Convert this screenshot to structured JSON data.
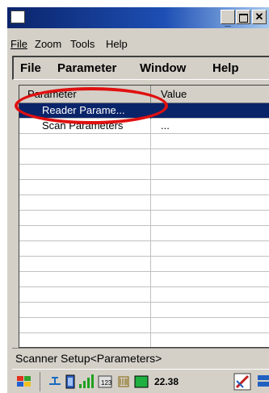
{
  "window": {
    "title": ""
  },
  "menubar_primary": {
    "items": [
      {
        "label": "File",
        "mnemonic": "F"
      },
      {
        "label": "Zoom",
        "mnemonic": "Z"
      },
      {
        "label": "Tools",
        "mnemonic": "T"
      },
      {
        "label": "Help",
        "mnemonic": "H"
      }
    ]
  },
  "menubar_secondary": {
    "items": [
      "File",
      "Parameter",
      "Window",
      "Help"
    ]
  },
  "grid": {
    "columns": [
      "Parameter",
      "Value"
    ],
    "rows": [
      {
        "parameter": "Reader Parame...",
        "value": "",
        "selected": true
      },
      {
        "parameter": "Scan Parameters",
        "value": "...",
        "selected": false
      }
    ],
    "empty_rows": 14
  },
  "status_bar": {
    "text": "Scanner Setup<Parameters>"
  },
  "taskbar": {
    "clock": "22.38",
    "icons": [
      "start-flag-icon",
      "network-icon",
      "battery-icon",
      "signal-icon",
      "keyboard-icon",
      "barcode-icon",
      "battery-green-icon",
      "pen-icon",
      "desktop-icon"
    ]
  },
  "colors": {
    "selection": "#0a246a",
    "highlight_ring": "#e01010",
    "titlebar": "#0a246a",
    "chrome": "#d4d0c8"
  }
}
